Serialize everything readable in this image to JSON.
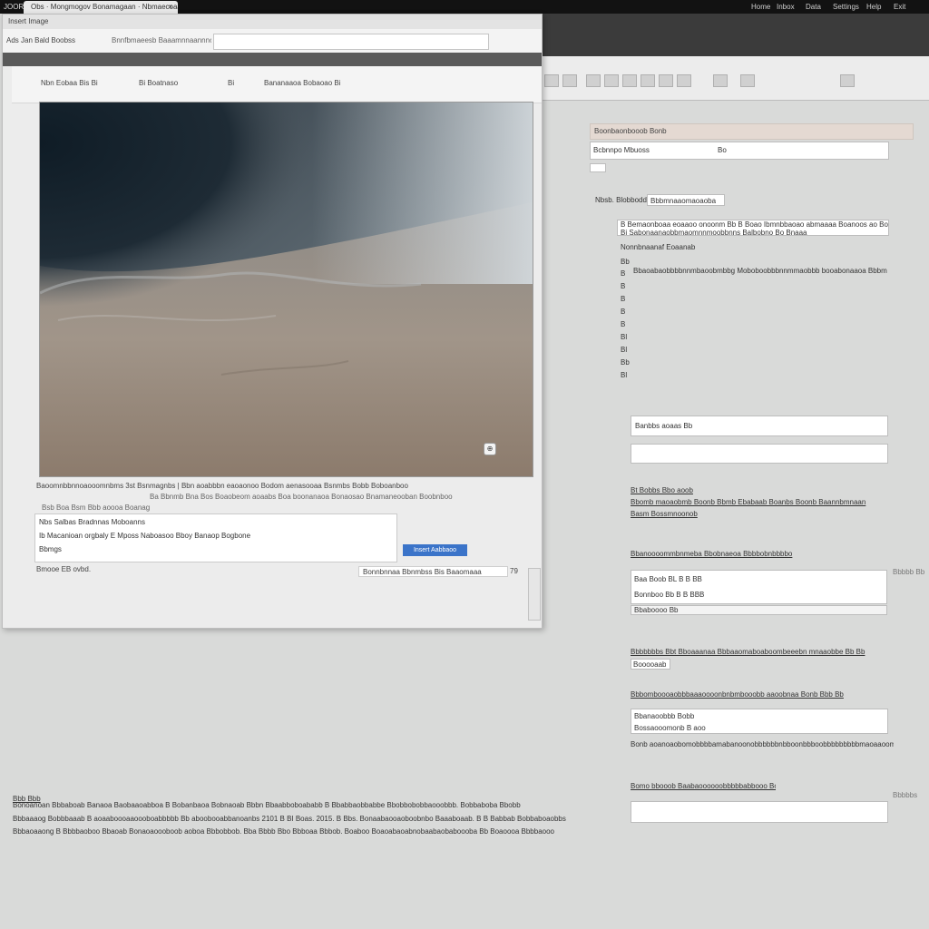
{
  "topbar": {
    "home_label": "JOOR",
    "tab_title": "Obs · Mongmogov Bonamagaan · Nbmaecoaanan",
    "tab_close": "×",
    "right_menu": [
      "Home",
      "Inbox",
      "Data",
      "Settings",
      "Help",
      "Exit"
    ]
  },
  "dialog": {
    "title": "Insert Image",
    "url_label": "Ads  Jan  Bald Boobss",
    "url_hint": "Bnnfbmaeesb  Baaamnnaannnon",
    "inner_tabs": [
      "Nbn Eobaa Bis  Bi",
      "Bi  Boatnaso",
      "Bi",
      "Bananaaoa Bobaoao Bi"
    ],
    "preview_badge": "⊕",
    "meta_row_1": "Baoomnbbnnoaooomnbms 3st   Bsnmagnbs   |   Bbn  aoabbbn eaoaonoo Bodom aenasooaa  Bsnmbs Bobb   Boboanboo",
    "meta_row_2": "Ba  Bbnmb Bna  Bos  Boaobeom  aoaabs  Boa boonanaoa  Bonaosao  Bnamaneooban  Boobnboo",
    "meta_row_3": "Bsb  Boa  Bsm  Bbb aoooa Boanag",
    "caption_lines": [
      "Nbs   Salbas Bradnnas  Moboanns",
      "Ib  Macanioan orgbaly E   Mposs  Naboasoo  Bboy  Banaop Bogbone",
      "Bbmgs"
    ],
    "caption_footer": "Bmooe  EB ovbd.",
    "insert_label": "Insert  Aabbaoo",
    "pager_text": "Bonnbnnaa  Bbnmbss  Bis  Baaomaaa",
    "pager_end": "79"
  },
  "panel": {
    "header": "Boonbaonbooob Bonb",
    "field1_label": "Bcbnnpo  Mbuoss",
    "field1_suffix": "Bo",
    "tab_label": "Nbsb. Blobbodd",
    "tab_value": "Bbbmnaaomaoaoba",
    "desc_1": "B  Bemaonboaa eoaaoo onoonm  Bb  B Boao Ibmnbbaoao abmaaaa  Boanoos ao Booomebb",
    "desc_2": "Bi  Sabonaanaobbmaomnnmoobbnns  Balbobno Bo Bnaaa",
    "list_heading": "Nonnbnaanaf Eoaanab",
    "list_line": "Bbaoabaobbbbnnmbaoobmbbg  Moboboobbbnnmmaobbb  booabonaaoa Bbbmo",
    "list_numbers": [
      "Bb",
      "B",
      "B",
      "B",
      "B",
      "B",
      "Bl",
      "Bl",
      "Bb",
      "Bl"
    ],
    "input_a_value": "Banbbs aoaas  Bb",
    "section2_title": "Bt  Bobbs   Bbo aoob",
    "section2_line1": "Bbomb maoaobmb Boonb Bbmb  Ebabaab  Boanbs  Boonb Baannbmnaan",
    "section2_line2": "Basm    Bossmnoonob",
    "section3_title": "Bbanoooommbnmeba  Bbobnaeoa  Bbbbobnbbbbo",
    "box3_line1": "Baa  Boob  BL  B B  BB",
    "box3_line2": "Bonnboo  Bb  B B  BBB",
    "box3_line3": "Bbaboooo   Bb",
    "box3_side": "Bbbbb Bb",
    "section4_line1": "Bbbbbbbs  Bbt  Bboaaanaa  Bbbaaomaboaboombeeebn  mnaaobbe  Bb Bb",
    "section4_line2": "Booooaab",
    "section5_title": "Bbbomboooaobbbaaaoooonbnbmbooobb aaoobnaa  Bonb Bbb  Bb",
    "box5_line1": "Bbanaoobbb  Bobb",
    "box5_line2": "Bossaooomonb  B aoo",
    "section5_line": "Bonb aoanoaobomobbbbamabanoonobbbbbbnbboonbbboobbbbbbbbbmaoaaoomb Bboombobbnboo  Bb",
    "section6_title": "Bomo  bbooob  Baabaoooooobbbbbabbooo  Boo",
    "section6_side": "Bbbbbs"
  },
  "bottom": {
    "label": "Bbb  Bbb",
    "line1": "Bonoanoan     Bbbaboab  Banaoa  Baobaaoabboa  B     Bobanbaoa  Bobnaoab  Bbbn   Bbaabboboababb  B    Bbabbaobbabbe    Bbobbobobbaooobbb.    Bobbaboba  Bbobb",
    "line2": "Bbbaaaog  Bobbbaaab   B aoaaboooaaoooboabbbbb  Bb aboobooabbanoanbs  2101 B   BI    Boas.     2015.   B  Bbs.   Bonaabaooaoboobnbo   Baaaboaab.   B  B    Babbab  Bobbaboaobbs",
    "line3": "Bbbaoaaong   B Bbbbaoboo   Bbaoab  Bonaoaoooboob   aoboa  Bbbobbob.   Bba  Bbbb    Bbo    Bbboaa  Bbbob.  Boaboo Boaoabaoabnobaabaobaboooba  Bb  Boaoooa  Bbbbaooo"
  },
  "colors": {
    "accent": "#3b74c9",
    "page_bg": "#d9dad9",
    "panel_header": "#e4d9d2"
  }
}
